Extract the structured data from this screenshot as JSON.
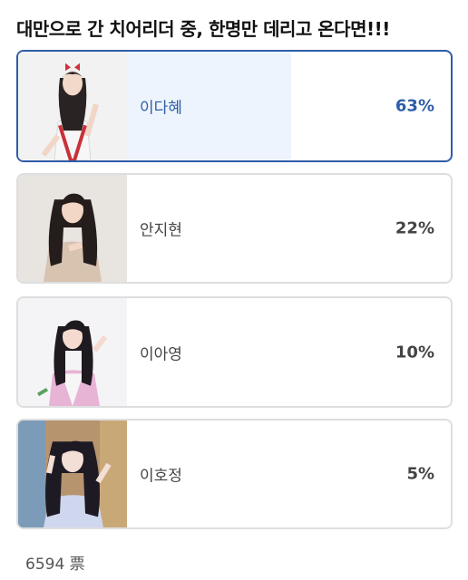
{
  "poll": {
    "title": "대만으로 간 치어리더 중, 한명만 데리고 온다면!!!",
    "options": [
      {
        "name": "이다혜",
        "percent_label": "63%",
        "percent": 63,
        "selected": true
      },
      {
        "name": "안지현",
        "percent_label": "22%",
        "percent": 22,
        "selected": false
      },
      {
        "name": "이아영",
        "percent_label": "10%",
        "percent": 10,
        "selected": false
      },
      {
        "name": "이호정",
        "percent_label": "5%",
        "percent": 5,
        "selected": false
      }
    ],
    "vote_count": "6594 票"
  },
  "colors": {
    "accent": "#2f5da8",
    "selected_fill": "#eef4fd",
    "unselected_fill": "#e9e9e9",
    "border": "#dedede"
  }
}
